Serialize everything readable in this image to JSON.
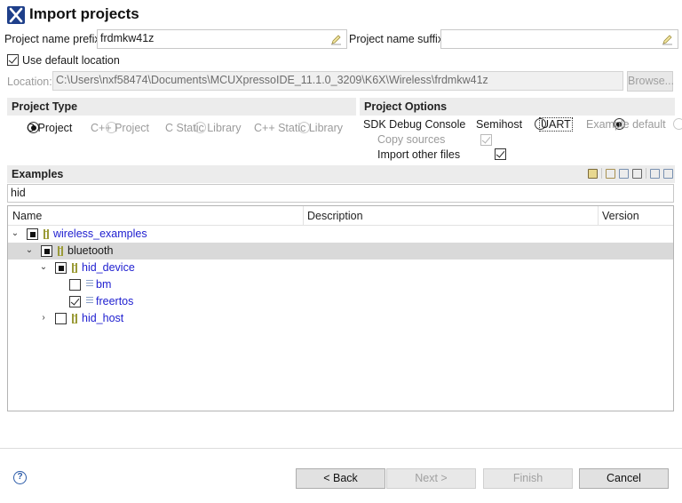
{
  "dialog": {
    "title": "Import projects"
  },
  "prefix": {
    "label": "Project name prefix:",
    "value": "frdmkw41z"
  },
  "suffix": {
    "label": "Project name suffix:",
    "value": ""
  },
  "default_location": {
    "label": "Use default location",
    "checked": true
  },
  "location": {
    "label": "Location:",
    "value": "C:\\Users\\nxf58474\\Documents\\MCUXpressoIDE_11.1.0_3209\\K6X\\Wireless\\frdmkw41z",
    "browse_label": "Browse..."
  },
  "project_type": {
    "header": "Project Type",
    "options": [
      "C Project",
      "C++ Project",
      "C Static Library",
      "C++ Static Library"
    ],
    "selected": "C Project"
  },
  "project_options": {
    "header": "Project Options",
    "sdk_label": "SDK Debug Console",
    "console_options": [
      "Semihost",
      "UART",
      "Example default"
    ],
    "selected": "UART",
    "copy_sources": "Copy sources",
    "import_other": "Import other files"
  },
  "examples": {
    "header": "Examples",
    "filter": "hid",
    "columns": [
      "Name",
      "Description",
      "Version"
    ],
    "tree": [
      {
        "label": "wireless_examples",
        "level": 0
      },
      {
        "label": "bluetooth",
        "level": 1
      },
      {
        "label": "hid_device",
        "level": 2
      },
      {
        "label": "bm",
        "level": 3
      },
      {
        "label": "freertos",
        "level": 3
      },
      {
        "label": "hid_host",
        "level": 2
      }
    ]
  },
  "footer": {
    "help": "?",
    "back": "< Back",
    "next": "Next >",
    "finish": "Finish",
    "cancel": "Cancel"
  },
  "colors": {
    "link": "#2020d0",
    "header_bg": "#ececec",
    "selected_row": "#d9d9d9",
    "icon_blue": "#1e3f8a"
  },
  "icons": [
    "app-x-icon",
    "pencil-icon",
    "folder-icon",
    "document-icon",
    "chevron-down-icon",
    "chevron-right-icon",
    "help-icon"
  ]
}
